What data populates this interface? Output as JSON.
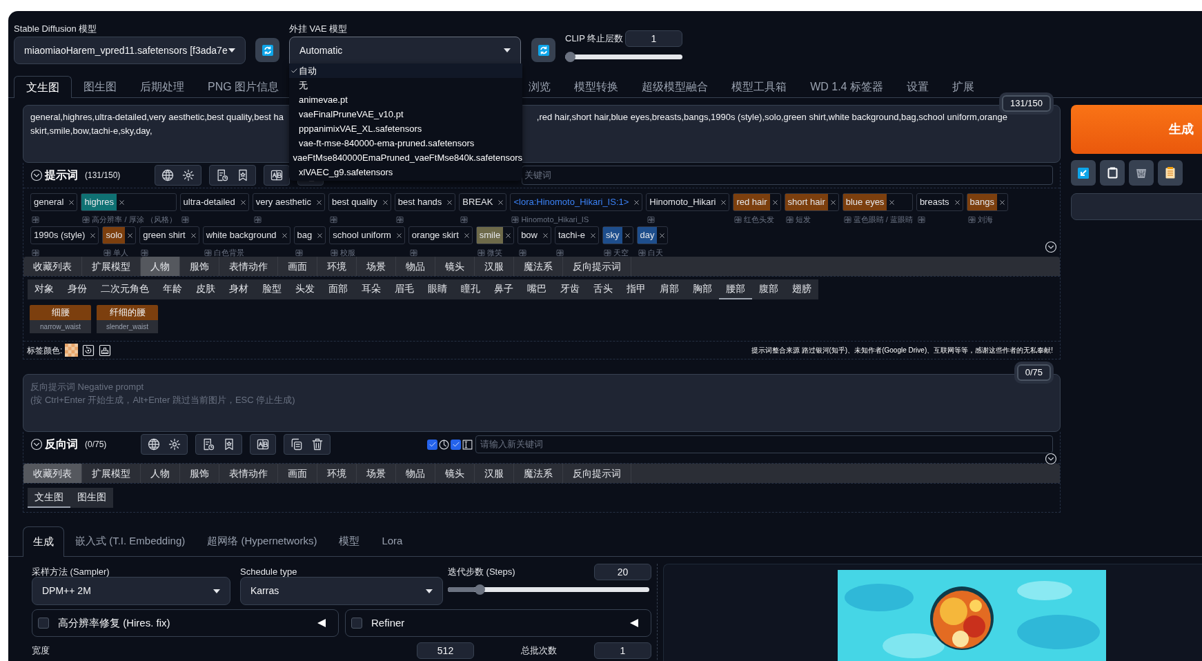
{
  "model_selector": {
    "label": "Stable Diffusion 模型",
    "value": "miaomiaoHarem_vpred11.safetensors [f3ada7e"
  },
  "vae_selector": {
    "label": "外挂 VAE 模型",
    "value": "Automatic",
    "expanded": true,
    "options": [
      {
        "label": "自动",
        "selected": true
      },
      {
        "label": "无",
        "selected": false
      },
      {
        "label": "animevae.pt",
        "selected": false
      },
      {
        "label": "vaeFinalPruneVAE_v10.pt",
        "selected": false
      },
      {
        "label": "pppanimixVAE_XL.safetensors",
        "selected": false
      },
      {
        "label": "vae-ft-mse-840000-ema-pruned.safetensors",
        "selected": false
      },
      {
        "label": "vaeFtMse840000EmaPruned_vaeFtMse840k.safetensors",
        "selected": false
      },
      {
        "label": "xlVAEC_g9.safetensors",
        "selected": false
      }
    ]
  },
  "clip_skip": {
    "label": "CLIP 终止层数",
    "value": "1",
    "level": 0
  },
  "main_tabs": [
    {
      "label": "文生图",
      "selected": true
    },
    {
      "label": "图生图",
      "selected": false
    },
    {
      "label": "后期处理",
      "selected": false
    },
    {
      "label": "PNG 图片信息",
      "selected": false
    },
    {
      "label": "浏览",
      "selected": false
    },
    {
      "label": "模型转换",
      "selected": false
    },
    {
      "label": "超级模型融合",
      "selected": false
    },
    {
      "label": "模型工具箱",
      "selected": false
    },
    {
      "label": "WD 1.4 标签器",
      "selected": false
    },
    {
      "label": "设置",
      "selected": false
    },
    {
      "label": "扩展",
      "selected": false
    }
  ],
  "prompt": {
    "line_1_left": "general,highres,ultra-detailed,very aesthetic,best quality,best ha",
    "line_1_right": ",red hair,short hair,blue eyes,breasts,bangs,1990s (style),solo,green shirt,white background,bag,school uniform,orange",
    "line_2": "skirt,smile,bow,tachi-e,sky,day,",
    "counter": "131/150",
    "title": "提示词",
    "count": "(131/150)",
    "keyword_placeholder": "关键词",
    "tag_rows": [
      {
        "tags": [
          {
            "text": "general",
            "kind": "word"
          },
          {
            "text": "highres",
            "kind": "word",
            "color": "#0f7173",
            "translation": "高分辨率 / 厚涂 （风格）"
          },
          {
            "text": "ultra-detailed",
            "kind": "word"
          },
          {
            "text": "very aesthetic",
            "kind": "word"
          },
          {
            "text": "best quality",
            "kind": "word"
          },
          {
            "text": "best hands",
            "kind": "word"
          },
          {
            "text": "BREAK",
            "kind": "word"
          },
          {
            "text": "<lora:Hinomoto_Hikari_IS:1>",
            "kind": "lora",
            "translation": "Hinomoto_Hikari_IS"
          },
          {
            "text": "Hinomoto_Hikari",
            "kind": "word"
          },
          {
            "text": "red hair",
            "kind": "word",
            "color": "#7c3f0e",
            "translation": "红色头发"
          },
          {
            "text": "short hair",
            "kind": "word",
            "color": "#7c3f0e",
            "translation": "短发"
          },
          {
            "text": "blue eyes",
            "kind": "word",
            "color": "#7c3f0e",
            "translation": "蓝色眼睛 / 蓝眼睛"
          },
          {
            "text": "breasts",
            "kind": "word"
          },
          {
            "text": "bangs",
            "kind": "word",
            "color": "#7c3f0e",
            "translation": "刘海"
          }
        ]
      },
      {
        "tags": [
          {
            "text": "1990s (style)",
            "kind": "word"
          },
          {
            "text": "solo",
            "kind": "word",
            "color": "#7c3f0e",
            "translation": "单人"
          },
          {
            "text": "green shirt",
            "kind": "word"
          },
          {
            "text": "white background",
            "kind": "word",
            "translation": "白色背景"
          },
          {
            "text": "bag",
            "kind": "word"
          },
          {
            "text": "school uniform",
            "kind": "word",
            "translation": "校服"
          },
          {
            "text": "orange skirt",
            "kind": "word"
          },
          {
            "text": "smile",
            "kind": "word",
            "color": "#6e6a4a",
            "translation": "微笑"
          },
          {
            "text": "bow",
            "kind": "word"
          },
          {
            "text": "tachi-e",
            "kind": "word"
          },
          {
            "text": "sky",
            "kind": "word",
            "color": "#1e4e8c",
            "translation": "天空"
          },
          {
            "text": "day",
            "kind": "word",
            "color": "#1e4e8c",
            "translation": "白天"
          }
        ]
      }
    ]
  },
  "tag_picker": {
    "categories": [
      {
        "label": "收藏列表",
        "selected": false
      },
      {
        "label": "扩展模型",
        "selected": false
      },
      {
        "label": "人物",
        "selected": true
      },
      {
        "label": "服饰",
        "selected": false
      },
      {
        "label": "表情动作",
        "selected": false
      },
      {
        "label": "画面",
        "selected": false
      },
      {
        "label": "环境",
        "selected": false
      },
      {
        "label": "场景",
        "selected": false
      },
      {
        "label": "物品",
        "selected": false
      },
      {
        "label": "镜头",
        "selected": false
      },
      {
        "label": "汉服",
        "selected": false
      },
      {
        "label": "魔法系",
        "selected": false
      },
      {
        "label": "反向提示词",
        "selected": false
      }
    ],
    "subcategories": [
      {
        "label": "对象",
        "selected": false
      },
      {
        "label": "身份",
        "selected": false
      },
      {
        "label": "二次元角色",
        "selected": false
      },
      {
        "label": "年龄",
        "selected": false
      },
      {
        "label": "皮肤",
        "selected": false
      },
      {
        "label": "身材",
        "selected": false
      },
      {
        "label": "脸型",
        "selected": false
      },
      {
        "label": "头发",
        "selected": false
      },
      {
        "label": "面部",
        "selected": false
      },
      {
        "label": "耳朵",
        "selected": false
      },
      {
        "label": "眉毛",
        "selected": false
      },
      {
        "label": "眼睛",
        "selected": false
      },
      {
        "label": "瞳孔",
        "selected": false
      },
      {
        "label": "鼻子",
        "selected": false
      },
      {
        "label": "嘴巴",
        "selected": false
      },
      {
        "label": "牙齿",
        "selected": false
      },
      {
        "label": "舌头",
        "selected": false
      },
      {
        "label": "指甲",
        "selected": false
      },
      {
        "label": "肩部",
        "selected": false
      },
      {
        "label": "胸部",
        "selected": false
      },
      {
        "label": "腰部",
        "selected": true
      },
      {
        "label": "腹部",
        "selected": false
      },
      {
        "label": "翅膀",
        "selected": false
      }
    ],
    "words": [
      {
        "label": "细腰",
        "tag": "narrow_waist"
      },
      {
        "label": "纤细的腰",
        "tag": "slender_waist"
      }
    ],
    "color_label": "标签颜色:",
    "credits": "提示词整合来源 路过银河(知乎)、未知作者(Google Drive)、互联网等等，感谢这些作者的无私奉献!"
  },
  "generate": {
    "label": "生成"
  },
  "negative": {
    "placeholder": "反向提示词 Negative prompt\n(按 Ctrl+Enter 开始生成，Alt+Enter 跳过当前图片，ESC 停止生成)",
    "counter": "0/75",
    "title": "反向词",
    "count": "(0/75)",
    "toggles": [
      {
        "kind": "history",
        "checked": true
      },
      {
        "kind": "text-cursor",
        "checked": true
      }
    ],
    "keyword_placeholder": "请输入新关键词",
    "categories": [
      {
        "label": "收藏列表",
        "selected": true
      },
      {
        "label": "扩展模型",
        "selected": false
      },
      {
        "label": "人物",
        "selected": false
      },
      {
        "label": "服饰",
        "selected": false
      },
      {
        "label": "表情动作",
        "selected": false
      },
      {
        "label": "画面",
        "selected": false
      },
      {
        "label": "环境",
        "selected": false
      },
      {
        "label": "场景",
        "selected": false
      },
      {
        "label": "物品",
        "selected": false
      },
      {
        "label": "镜头",
        "selected": false
      },
      {
        "label": "汉服",
        "selected": false
      },
      {
        "label": "魔法系",
        "selected": false
      },
      {
        "label": "反向提示词",
        "selected": false
      }
    ],
    "subtabs": [
      {
        "label": "文生图",
        "selected": true
      },
      {
        "label": "图生图",
        "selected": false
      }
    ]
  },
  "generation_tabs": [
    {
      "label": "生成",
      "selected": true
    },
    {
      "label": "嵌入式 (T.I. Embedding)",
      "selected": false
    },
    {
      "label": "超网络 (Hypernetworks)",
      "selected": false
    },
    {
      "label": "模型",
      "selected": false
    },
    {
      "label": "Lora",
      "selected": false
    }
  ],
  "sampler": {
    "label": "采样方法 (Sampler)",
    "value": "DPM++ 2M"
  },
  "schedule": {
    "label": "Schedule type",
    "value": "Karras"
  },
  "steps": {
    "label": "迭代步数 (Steps)",
    "value": "20",
    "level": 0.14
  },
  "hires_fix": {
    "label": "高分辨率修复 (Hires. fix)",
    "checked": false
  },
  "refiner": {
    "label": "Refiner",
    "checked": false
  },
  "width": {
    "label": "宽度",
    "value": "512"
  },
  "batch_count": {
    "label": "总批次数",
    "value": "1"
  }
}
